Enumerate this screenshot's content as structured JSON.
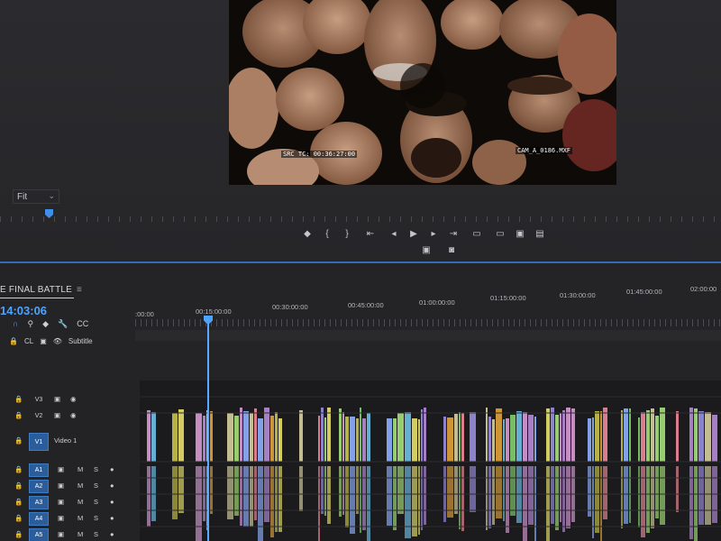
{
  "monitor": {
    "view_select": "Fit",
    "burn_in_timecodes": [
      "SRC TC: 00:36:27:00",
      "CAM_A_0186.MXF"
    ]
  },
  "transport": {
    "buttons": [
      "marker",
      "in-point",
      "out-point",
      "go-to-in",
      "step-back",
      "play",
      "step-forward",
      "go-to-out",
      "lift",
      "extract",
      "export-frame",
      "button-editor"
    ],
    "glyphs": [
      "◆",
      "{",
      "}",
      "⇤",
      "◂",
      "▶",
      "▸",
      "⇥",
      "▭",
      "▭",
      "▣",
      "▤"
    ],
    "row2_glyphs": [
      "▣",
      "◙"
    ]
  },
  "timeline": {
    "sequence_name": "E FINAL BATTLE",
    "menu_glyph": "≡",
    "timecode": "14:03:06",
    "ruler_labels": [
      ":00:00",
      "00:15:00:00",
      "00:30:00:00",
      "00:45:00:00",
      "01:00:00:00",
      "01:15:00:00",
      "01:30:00:00",
      "01:45:00:00",
      "02:00:00"
    ],
    "tools_row1": [
      "∩",
      "⚲",
      "◆",
      "🔧",
      "CC"
    ],
    "tools_row2": [
      "🔒",
      "CL",
      "▣",
      "👁",
      "Subtitle"
    ],
    "tracks": [
      {
        "id": "V3",
        "label": "",
        "kind": "video"
      },
      {
        "id": "V2",
        "label": "",
        "kind": "video"
      },
      {
        "id": "V1",
        "label": "Video 1",
        "kind": "video"
      },
      {
        "id": "A1",
        "label": "",
        "kind": "audio"
      },
      {
        "id": "A2",
        "label": "",
        "kind": "audio"
      },
      {
        "id": "A3",
        "label": "",
        "kind": "audio"
      },
      {
        "id": "A4",
        "label": "",
        "kind": "audio"
      },
      {
        "id": "A5",
        "label": "",
        "kind": "audio"
      }
    ],
    "audio_toggles": [
      "M",
      "S"
    ]
  },
  "colors": {
    "accent": "#4ea3ff",
    "panel_bg": "#242427",
    "track_target": "#2b5d9a"
  }
}
